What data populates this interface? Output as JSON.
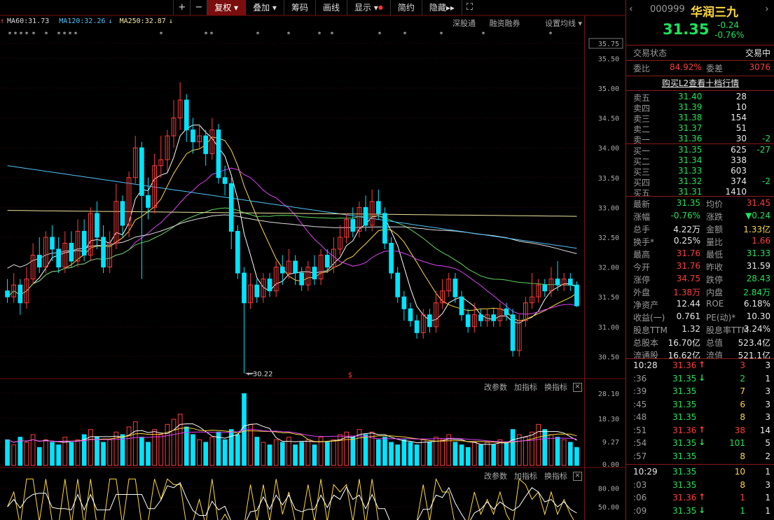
{
  "toolbar": {
    "plus": "+",
    "minus": "−",
    "buttons": [
      "复权",
      "叠加",
      "筹码",
      "画线",
      "显示",
      "简约",
      "隐藏"
    ],
    "fullscreen_icon": "fullscreen-icon"
  },
  "ma_legend": [
    {
      "label": "MA60:31.73",
      "color": "#dddddd",
      "arrow": "↑"
    },
    {
      "label": "MA120:32.26",
      "color": "#4fc3f7",
      "arrow": "↓"
    },
    {
      "label": "MA250:32.87",
      "color": "#f0e6a0",
      "arrow": "↓"
    }
  ],
  "chart_links": [
    "深股通",
    "融资融券",
    "设置均线"
  ],
  "price_axis": [
    "35.75",
    "35.50",
    "35.00",
    "34.50",
    "34.00",
    "33.50",
    "33.00",
    "32.50",
    "32.00",
    "31.50",
    "31.00",
    "30.50"
  ],
  "low_annotation": "30.22",
  "volume_toolbar": [
    "改参数",
    "加指标",
    "换指标"
  ],
  "volume_axis": [
    "28.10",
    "18.30",
    "9.27",
    "0.00"
  ],
  "indicator_toolbar": [
    "改参数",
    "加指标",
    "换指标"
  ],
  "indicator_axis": [
    "80.00",
    "50.00"
  ],
  "stock": {
    "code": "000999",
    "name": "华润三九",
    "price": "31.35",
    "change": "-0.24",
    "change_pct": "-0.76%"
  },
  "status": {
    "label": "交易状态",
    "value": "交易中"
  },
  "weibi": {
    "label": "委比",
    "value": "84.92%",
    "diff_label": "委差",
    "diff_value": "3076"
  },
  "l2_link": "购买L2查看十档行情",
  "sell_orders": [
    {
      "label": "卖五",
      "price": "31.40",
      "vol": "28",
      "chg": ""
    },
    {
      "label": "卖四",
      "price": "31.39",
      "vol": "10",
      "chg": ""
    },
    {
      "label": "卖三",
      "price": "31.38",
      "vol": "154",
      "chg": ""
    },
    {
      "label": "卖二",
      "price": "31.37",
      "vol": "51",
      "chg": ""
    },
    {
      "label": "卖一",
      "price": "31.36",
      "vol": "30",
      "chg": "-2"
    }
  ],
  "buy_orders": [
    {
      "label": "买一",
      "price": "31.35",
      "vol": "625",
      "chg": "-27"
    },
    {
      "label": "买二",
      "price": "31.34",
      "vol": "338",
      "chg": ""
    },
    {
      "label": "买三",
      "price": "31.33",
      "vol": "603",
      "chg": ""
    },
    {
      "label": "买四",
      "price": "31.32",
      "vol": "374",
      "chg": "-2"
    },
    {
      "label": "买五",
      "price": "31.31",
      "vol": "1410",
      "chg": ""
    }
  ],
  "quote": [
    {
      "l1": "最新",
      "v1": "31.35",
      "c1": "green",
      "l2": "均价",
      "v2": "31.45",
      "c2": "red"
    },
    {
      "l1": "涨幅",
      "v1": "-0.76%",
      "c1": "green",
      "l2": "涨跌",
      "v2": "▼0.24",
      "c2": "green"
    },
    {
      "l1": "总手",
      "v1": "4.22万",
      "c1": "white",
      "l2": "金额",
      "v2": "1.33亿",
      "c2": "yellow"
    },
    {
      "l1": "换手*",
      "v1": "0.25%",
      "c1": "white",
      "l2": "量比",
      "v2": "1.66",
      "c2": "red"
    },
    {
      "l1": "最高",
      "v1": "31.76",
      "c1": "red",
      "l2": "最低",
      "v2": "31.33",
      "c2": "green"
    },
    {
      "l1": "今开",
      "v1": "31.76",
      "c1": "red",
      "l2": "昨收",
      "v2": "31.59",
      "c2": "white"
    },
    {
      "l1": "涨停",
      "v1": "34.75",
      "c1": "red",
      "l2": "跌停",
      "v2": "28.43",
      "c2": "green"
    },
    {
      "l1": "外盘",
      "v1": "1.38万",
      "c1": "red",
      "l2": "内盘",
      "v2": "2.84万",
      "c2": "green"
    },
    {
      "l1": "净资产",
      "v1": "12.44",
      "c1": "white",
      "l2": "ROE",
      "v2": "6.18%",
      "c2": "white"
    },
    {
      "l1": "收益(一)",
      "v1": "0.761",
      "c1": "white",
      "l2": "PE(动)*",
      "v2": "10.30",
      "c2": "white"
    },
    {
      "l1": "股息TTM",
      "v1": "1.32",
      "c1": "white",
      "l2": "股息率TTM",
      "v2": "3.24%",
      "c2": "white"
    },
    {
      "l1": "总股本",
      "v1": "16.70亿",
      "c1": "white",
      "l2": "总值",
      "v2": "523.4亿",
      "c2": "white"
    },
    {
      "l1": "流通股",
      "v1": "16.62亿",
      "c1": "white",
      "l2": "流值",
      "v2": "521.1亿",
      "c2": "white"
    }
  ],
  "ticks": [
    {
      "time": "10:28",
      "price": "31.36",
      "dir": "up",
      "vol": "3",
      "n": "3"
    },
    {
      "time": ":36",
      "price": "31.35",
      "dir": "down",
      "vol": "2",
      "n": "1"
    },
    {
      "time": ":39",
      "price": "31.35",
      "dir": "",
      "vol": "7",
      "n": "3"
    },
    {
      "time": ":45",
      "price": "31.35",
      "dir": "",
      "vol": "6",
      "n": "3"
    },
    {
      "time": ":48",
      "price": "31.35",
      "dir": "",
      "vol": "8",
      "n": "3"
    },
    {
      "time": ":51",
      "price": "31.36",
      "dir": "up",
      "vol": "38",
      "n": "14"
    },
    {
      "time": ":54",
      "price": "31.35",
      "dir": "down",
      "vol": "101",
      "n": "5"
    },
    {
      "time": ":57",
      "price": "31.35",
      "dir": "",
      "vol": "8",
      "n": "2"
    },
    {
      "time": "10:29",
      "price": "31.35",
      "dir": "",
      "vol": "10",
      "n": "1"
    },
    {
      "time": ":03",
      "price": "31.35",
      "dir": "",
      "vol": "8",
      "n": "3"
    },
    {
      "time": ":06",
      "price": "31.36",
      "dir": "up",
      "vol": "1",
      "n": "1"
    },
    {
      "time": ":09",
      "price": "31.35",
      "dir": "down",
      "vol": "1",
      "n": "1"
    }
  ],
  "chart_data": {
    "type": "candlestick",
    "ylim": [
      30.2,
      35.75
    ],
    "candles": [
      [
        31.6,
        31.5,
        31.8,
        31.4
      ],
      [
        31.5,
        31.7,
        31.9,
        31.4
      ],
      [
        31.7,
        31.4,
        31.8,
        31.2
      ],
      [
        31.4,
        31.8,
        32.0,
        31.3
      ],
      [
        31.8,
        32.2,
        32.4,
        31.7
      ],
      [
        32.2,
        32.0,
        32.5,
        31.9
      ],
      [
        32.0,
        32.5,
        32.6,
        31.9
      ],
      [
        32.5,
        32.3,
        32.7,
        32.1
      ],
      [
        32.3,
        32.0,
        32.5,
        31.9
      ],
      [
        32.0,
        32.4,
        32.6,
        31.9
      ],
      [
        32.4,
        32.1,
        32.6,
        32.0
      ],
      [
        32.1,
        32.6,
        32.8,
        32.0
      ],
      [
        32.6,
        32.2,
        32.8,
        32.1
      ],
      [
        32.2,
        32.9,
        33.0,
        32.1
      ],
      [
        32.9,
        32.5,
        33.1,
        32.3
      ],
      [
        32.5,
        32.0,
        32.7,
        31.9
      ],
      [
        32.0,
        32.4,
        32.6,
        31.9
      ],
      [
        32.4,
        33.1,
        33.4,
        32.3
      ],
      [
        33.1,
        32.7,
        33.2,
        32.5
      ],
      [
        32.7,
        33.5,
        33.6,
        32.5
      ],
      [
        33.5,
        34.0,
        34.2,
        33.4
      ],
      [
        34.0,
        33.2,
        34.1,
        31.8
      ],
      [
        33.2,
        33.0,
        33.5,
        32.8
      ],
      [
        33.0,
        33.7,
        33.9,
        32.9
      ],
      [
        33.7,
        33.8,
        34.2,
        33.5
      ],
      [
        33.8,
        34.2,
        34.3,
        33.6
      ],
      [
        34.2,
        34.5,
        34.8,
        34.0
      ],
      [
        34.5,
        34.8,
        35.1,
        34.3
      ],
      [
        34.8,
        34.3,
        34.9,
        34.1
      ],
      [
        34.3,
        34.1,
        34.5,
        33.9
      ],
      [
        34.1,
        34.2,
        34.4,
        34.0
      ],
      [
        34.2,
        33.9,
        34.3,
        33.7
      ],
      [
        33.9,
        34.3,
        34.5,
        33.8
      ],
      [
        34.3,
        33.5,
        34.4,
        33.4
      ],
      [
        33.5,
        33.4,
        33.7,
        33.2
      ],
      [
        33.4,
        32.6,
        33.5,
        32.3
      ],
      [
        32.6,
        31.9,
        32.7,
        31.8
      ],
      [
        31.9,
        31.4,
        32.0,
        30.22
      ],
      [
        31.4,
        31.7,
        31.9,
        31.3
      ],
      [
        31.7,
        31.5,
        31.8,
        31.4
      ],
      [
        31.5,
        31.8,
        31.9,
        31.4
      ],
      [
        31.8,
        31.6,
        31.9,
        31.5
      ],
      [
        31.6,
        32.0,
        32.1,
        31.5
      ],
      [
        32.0,
        31.9,
        32.2,
        31.7
      ],
      [
        31.9,
        32.1,
        32.3,
        31.8
      ],
      [
        32.1,
        31.9,
        32.2,
        31.7
      ],
      [
        31.9,
        31.7,
        32.0,
        31.6
      ],
      [
        31.7,
        32.0,
        32.1,
        31.6
      ],
      [
        32.0,
        31.8,
        32.2,
        31.7
      ],
      [
        31.8,
        32.2,
        32.3,
        31.7
      ],
      [
        32.2,
        32.0,
        32.3,
        31.9
      ],
      [
        32.0,
        32.3,
        32.5,
        31.9
      ],
      [
        32.3,
        32.5,
        32.7,
        32.2
      ],
      [
        32.5,
        32.8,
        32.9,
        32.4
      ],
      [
        32.8,
        32.6,
        33.0,
        32.5
      ],
      [
        32.6,
        33.0,
        33.1,
        32.5
      ],
      [
        33.0,
        32.7,
        33.2,
        32.6
      ],
      [
        32.7,
        33.1,
        33.3,
        32.6
      ],
      [
        33.1,
        32.9,
        33.3,
        32.8
      ],
      [
        32.9,
        32.4,
        33.0,
        32.3
      ],
      [
        32.4,
        31.9,
        32.5,
        31.8
      ],
      [
        31.9,
        31.5,
        32.0,
        31.4
      ],
      [
        31.5,
        31.3,
        31.6,
        31.1
      ],
      [
        31.3,
        31.1,
        31.4,
        31.0
      ],
      [
        31.1,
        30.9,
        31.2,
        30.8
      ],
      [
        30.9,
        31.2,
        31.3,
        30.8
      ],
      [
        31.2,
        31.0,
        31.3,
        30.9
      ],
      [
        31.0,
        31.4,
        31.6,
        30.9
      ],
      [
        31.4,
        31.6,
        31.8,
        31.3
      ],
      [
        31.6,
        31.8,
        31.9,
        31.5
      ],
      [
        31.8,
        31.5,
        31.9,
        31.4
      ],
      [
        31.5,
        31.2,
        31.6,
        31.1
      ],
      [
        31.2,
        31.0,
        31.3,
        30.9
      ],
      [
        31.0,
        31.2,
        31.4,
        30.9
      ],
      [
        31.2,
        31.1,
        31.3,
        31.0
      ],
      [
        31.1,
        31.2,
        31.3,
        31.0
      ],
      [
        31.2,
        31.1,
        31.3,
        31.0
      ],
      [
        31.1,
        31.3,
        31.4,
        31.0
      ],
      [
        31.3,
        31.2,
        31.4,
        31.1
      ],
      [
        31.2,
        30.6,
        31.3,
        30.5
      ],
      [
        30.6,
        31.1,
        31.2,
        30.5
      ],
      [
        31.1,
        31.4,
        31.5,
        31.0
      ],
      [
        31.4,
        31.5,
        31.9,
        31.3
      ],
      [
        31.5,
        31.7,
        31.8,
        31.4
      ],
      [
        31.7,
        31.6,
        31.8,
        31.5
      ],
      [
        31.6,
        31.8,
        32.0,
        31.5
      ],
      [
        31.8,
        31.7,
        32.1,
        31.6
      ],
      [
        31.7,
        31.8,
        31.9,
        31.6
      ],
      [
        31.8,
        31.7,
        31.9,
        31.6
      ],
      [
        31.7,
        31.35,
        31.76,
        31.33
      ]
    ],
    "volumes": [
      10,
      8,
      11,
      9,
      12,
      7,
      10,
      9,
      8,
      11,
      9,
      10,
      12,
      14,
      11,
      9,
      10,
      13,
      12,
      15,
      17,
      11,
      9,
      14,
      12,
      16,
      18,
      20,
      15,
      12,
      10,
      9,
      11,
      13,
      10,
      14,
      12,
      28,
      16,
      11,
      9,
      8,
      10,
      9,
      11,
      8,
      9,
      10,
      8,
      11,
      9,
      10,
      12,
      13,
      11,
      14,
      12,
      13,
      10,
      11,
      9,
      8,
      10,
      9,
      8,
      10,
      9,
      11,
      10,
      12,
      9,
      8,
      7,
      9,
      8,
      9,
      8,
      10,
      9,
      14,
      12,
      11,
      13,
      16,
      14,
      12,
      11,
      10,
      9,
      7
    ]
  }
}
